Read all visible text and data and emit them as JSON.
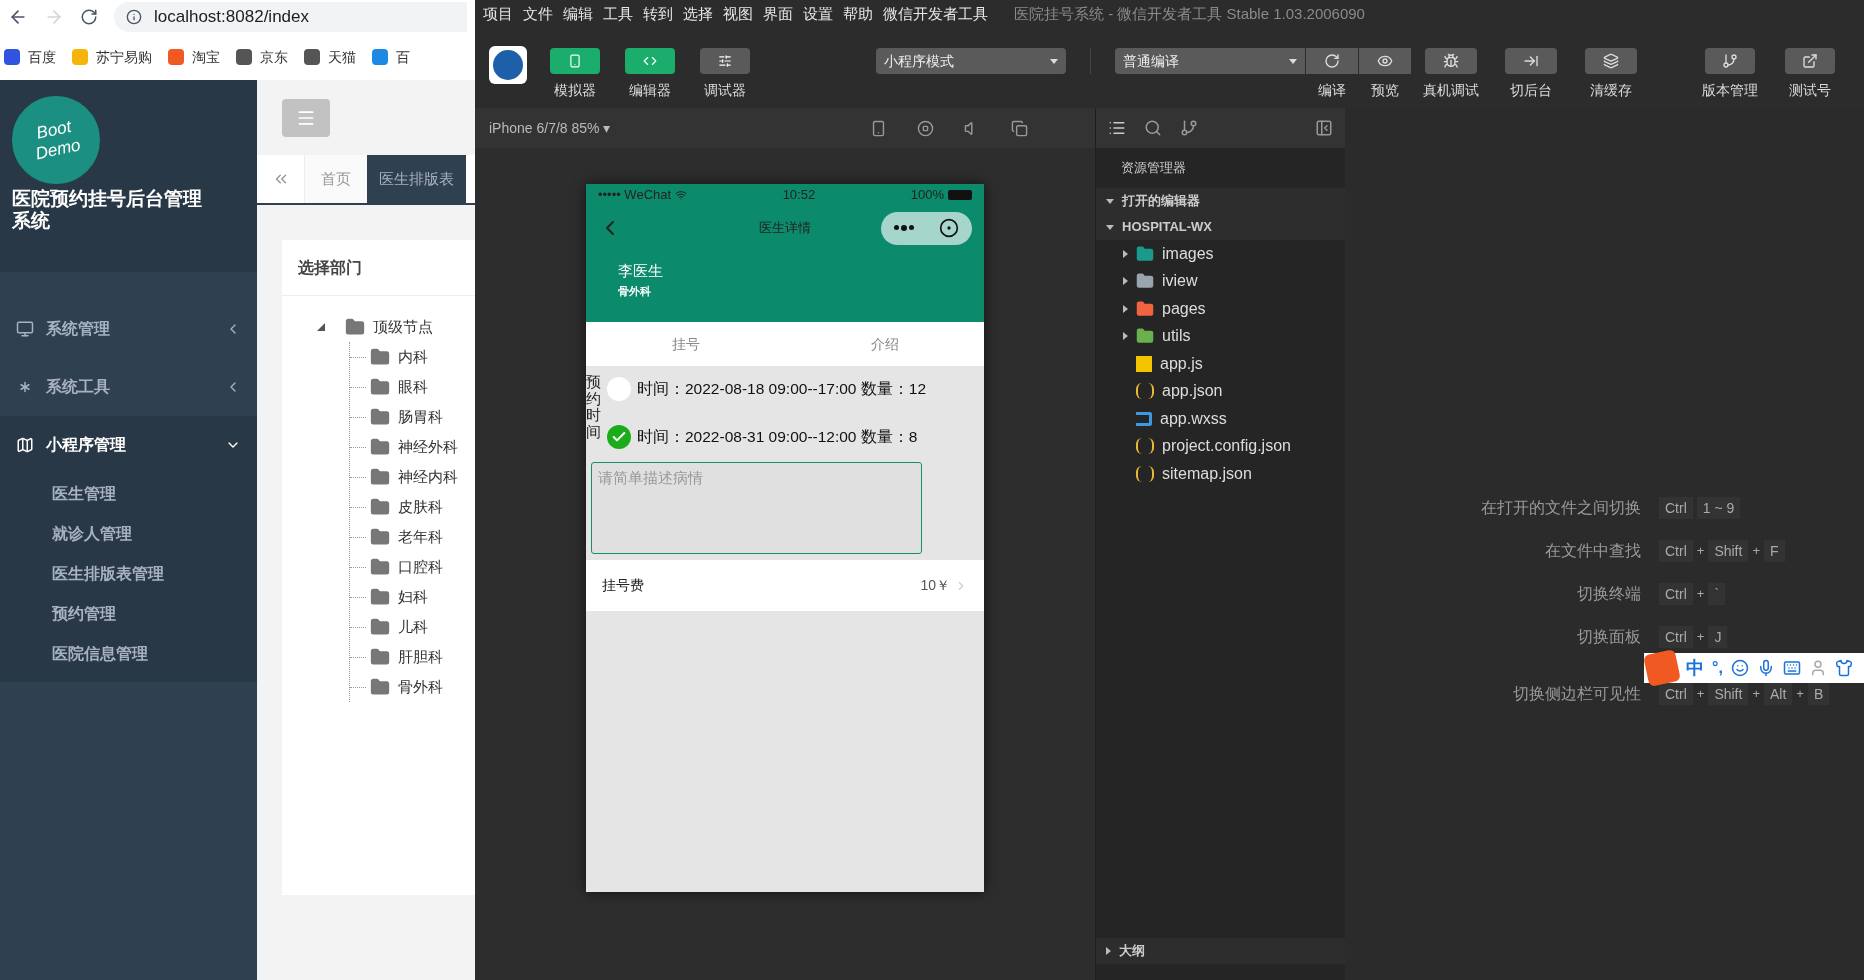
{
  "browser": {
    "url": "localhost:8082/index",
    "bookmarks": [
      {
        "label": "百度",
        "color": "#3053e0"
      },
      {
        "label": "苏宁易购",
        "color": "#f5b50b"
      },
      {
        "label": "淘宝",
        "color": "#f05a22"
      },
      {
        "label": "京东",
        "color": "#555555"
      },
      {
        "label": "天猫",
        "color": "#555555"
      },
      {
        "label": "百",
        "color": "#1e88e5"
      }
    ]
  },
  "admin": {
    "logo": [
      "Boot",
      "Demo"
    ],
    "title": "医院预约挂号后台管理系统",
    "menu": [
      {
        "label": "系统管理",
        "expanded": false
      },
      {
        "label": "系统工具",
        "expanded": false
      },
      {
        "label": "小程序管理",
        "expanded": true,
        "children": [
          "医生管理",
          "就诊人管理",
          "医生排版表管理",
          "预约管理",
          "医院信息管理"
        ]
      }
    ],
    "tabs": [
      {
        "label": "首页",
        "selected": false
      },
      {
        "label": "医生排版表",
        "selected": true
      }
    ],
    "card_title": "选择部门",
    "tree": {
      "label": "顶级节点",
      "expanded": true,
      "children": [
        "内科",
        "眼科",
        "肠胃科",
        "神经外科",
        "神经内科",
        "皮肤科",
        "老年科",
        "口腔科",
        "妇科",
        "儿科",
        "肝胆科",
        "骨外科"
      ]
    }
  },
  "devtools": {
    "menu": [
      "项目",
      "文件",
      "编辑",
      "工具",
      "转到",
      "选择",
      "视图",
      "界面",
      "设置",
      "帮助",
      "微信开发者工具"
    ],
    "title": "医院挂号系统 - 微信开发者工具 Stable 1.03.2006090",
    "panels": [
      {
        "label": "模拟器",
        "active": true
      },
      {
        "label": "编辑器",
        "active": true
      },
      {
        "label": "调试器",
        "active": false
      }
    ],
    "mode": "小程序模式",
    "compile": "普通编译",
    "actions": [
      {
        "label": "编译"
      },
      {
        "label": "预览"
      },
      {
        "label": "真机调试"
      },
      {
        "label": "切后台"
      },
      {
        "label": "清缓存"
      }
    ],
    "right_actions": [
      {
        "label": "版本管理"
      },
      {
        "label": "测试号"
      }
    ],
    "device": "iPhone 6/7/8 85% ▾",
    "phone": {
      "carrier": "••••• WeChat",
      "time": "10:52",
      "battery": "100%",
      "nav_title": "医生详情",
      "doctor": "李医生",
      "department": "骨外科",
      "tabs": [
        "挂号",
        "介绍"
      ],
      "schedule_label": "预约时间",
      "slots": [
        {
          "text": "时间：2022-08-18 09:00--17:00 数量：12",
          "checked": false
        },
        {
          "text": "时间：2022-08-31 09:00--12:00 数量：8",
          "checked": true
        }
      ],
      "placeholder": "请简单描述病情",
      "fee_label": "挂号费",
      "fee_value": "10￥"
    },
    "explorer": {
      "title": "资源管理器",
      "sections": [
        {
          "label": "打开的编辑器",
          "expanded": true
        },
        {
          "label": "HOSPITAL-WX",
          "expanded": true,
          "children": [
            {
              "name": "images",
              "kind": "folder",
              "color": "#1a9a8a"
            },
            {
              "name": "iview",
              "kind": "folder",
              "color": "#9aa4ad"
            },
            {
              "name": "pages",
              "kind": "folder",
              "color": "#f0653f"
            },
            {
              "name": "utils",
              "kind": "folder",
              "color": "#6ab04c"
            },
            {
              "name": "app.js",
              "kind": "js"
            },
            {
              "name": "app.json",
              "kind": "json"
            },
            {
              "name": "app.wxss",
              "kind": "css"
            },
            {
              "name": "project.config.json",
              "kind": "json"
            },
            {
              "name": "sitemap.json",
              "kind": "json"
            }
          ]
        },
        {
          "label": "大纲",
          "expanded": false
        }
      ]
    },
    "shortcuts": [
      {
        "label": "在打开的文件之间切换",
        "keys": [
          {
            "kind": "key",
            "text": "Ctrl"
          },
          {
            "kind": "key",
            "text": "1 ~ 9"
          }
        ]
      },
      {
        "label": "在文件中查找",
        "keys": [
          {
            "kind": "key",
            "text": "Ctrl"
          },
          {
            "kind": "sep",
            "text": "+"
          },
          {
            "kind": "key",
            "text": "Shift"
          },
          {
            "kind": "sep",
            "text": "+"
          },
          {
            "kind": "key",
            "text": "F"
          }
        ]
      },
      {
        "label": "切换终端",
        "keys": [
          {
            "kind": "key",
            "text": "Ctrl"
          },
          {
            "kind": "sep",
            "text": "+"
          },
          {
            "kind": "key",
            "text": "`"
          }
        ]
      },
      {
        "label": "切换面板",
        "keys": [
          {
            "kind": "key",
            "text": "Ctrl"
          },
          {
            "kind": "sep",
            "text": "+"
          },
          {
            "kind": "key",
            "text": "J"
          }
        ]
      },
      {
        "label": "切换侧边栏可见性",
        "keys": [
          {
            "kind": "key",
            "text": "Ctrl"
          },
          {
            "kind": "sep",
            "text": "+"
          },
          {
            "kind": "key",
            "text": "Shift"
          },
          {
            "kind": "sep",
            "text": "+"
          },
          {
            "kind": "key",
            "text": "Alt"
          },
          {
            "kind": "sep",
            "text": "+"
          },
          {
            "kind": "key",
            "text": "B"
          }
        ]
      }
    ],
    "ime": {
      "mode": "中",
      "punct": "°,"
    }
  }
}
